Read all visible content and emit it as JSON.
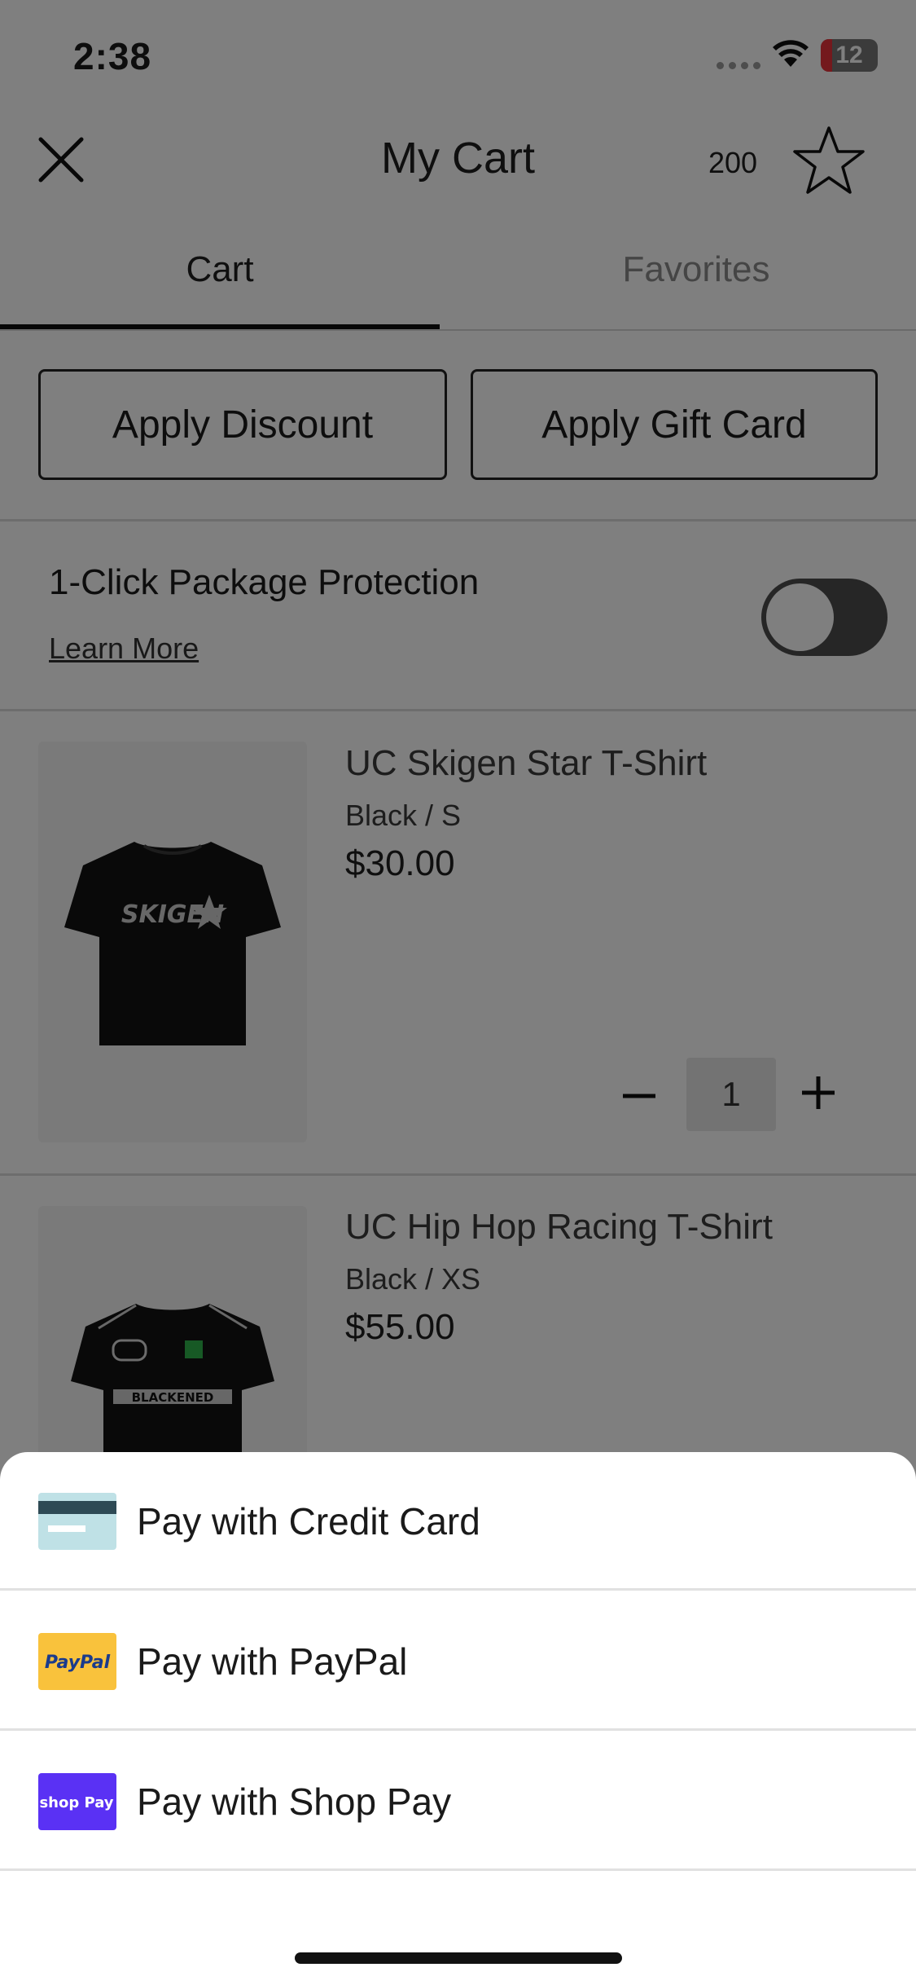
{
  "status_bar": {
    "time": "2:38",
    "battery": "12"
  },
  "header": {
    "title": "My Cart",
    "points": "200"
  },
  "tabs": [
    {
      "label": "Cart"
    },
    {
      "label": "Favorites"
    }
  ],
  "actions": {
    "discount_label": "Apply Discount",
    "gift_card_label": "Apply Gift Card"
  },
  "protection": {
    "title": "1-Click Package Protection",
    "learn_more": "Learn More",
    "enabled": false
  },
  "cart_items": [
    {
      "name": "UC Skigen Star T-Shirt",
      "variant": "Black / S",
      "price": "$30.00",
      "quantity": "1",
      "graphic_text": "SKIGEN"
    },
    {
      "name": "UC Hip Hop Racing T-Shirt",
      "variant": "Black / XS",
      "price": "$55.00",
      "graphic_text": "BLACKENED"
    }
  ],
  "payment_sheet": {
    "options": [
      {
        "label": "Pay with Credit Card",
        "icon": "credit-card-icon"
      },
      {
        "label": "Pay with PayPal",
        "icon": "paypal-icon",
        "logo_text": "PayPal"
      },
      {
        "label": "Pay with Shop Pay",
        "icon": "shop-pay-icon",
        "logo_text": "shop Pay"
      }
    ]
  },
  "colors": {
    "paypal": "#F9C23C",
    "shop_pay": "#5A31F4",
    "card_stripe": "#2E4A55",
    "card_body": "#BFE1E6"
  }
}
